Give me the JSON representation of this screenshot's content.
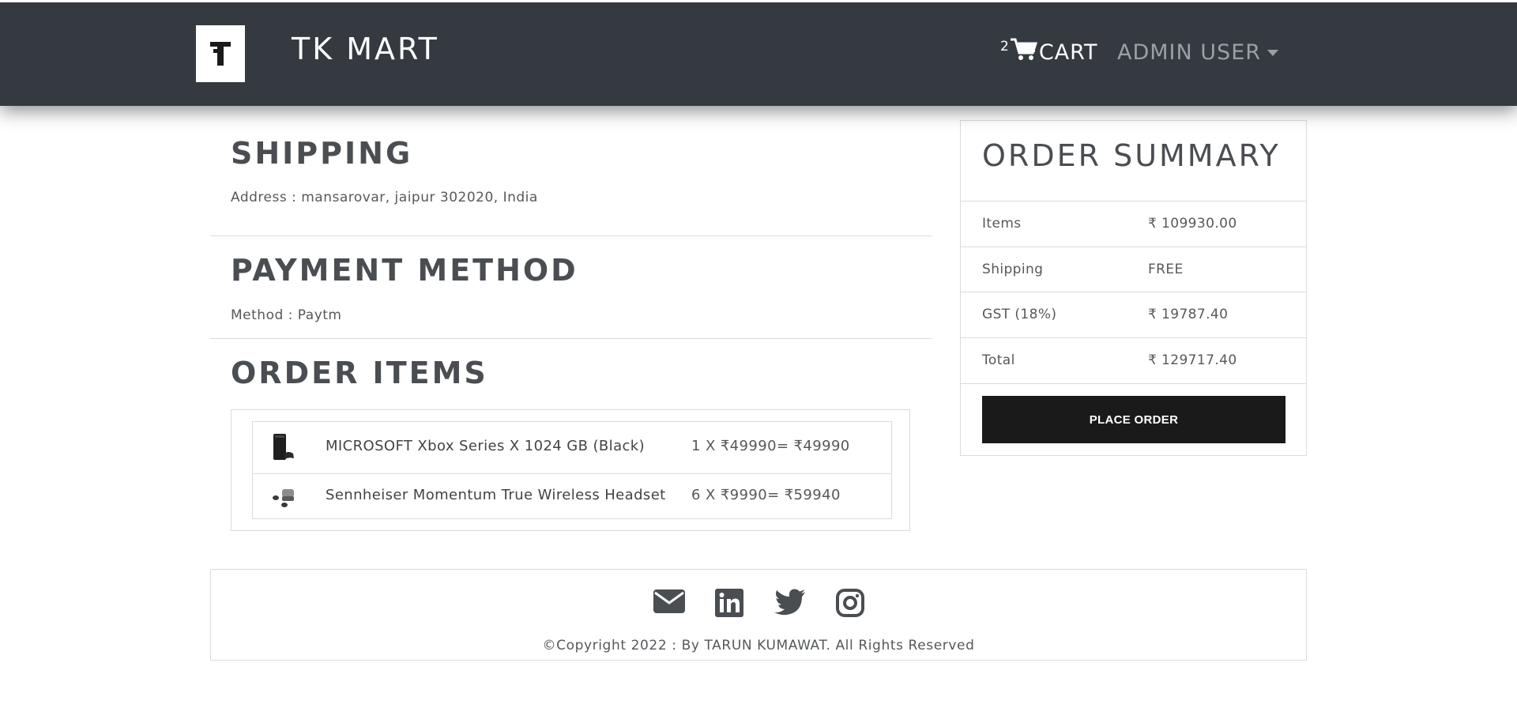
{
  "navbar": {
    "brand": "TK MART",
    "cart_count": "2",
    "cart_label": "CART",
    "user_label": "ADMIN USER"
  },
  "shipping": {
    "title": "SHIPPING",
    "address": "Address : mansarovar, jaipur 302020, India"
  },
  "payment": {
    "title": "PAYMENT METHOD",
    "method": "Method : Paytm"
  },
  "order_items": {
    "title": "ORDER ITEMS",
    "items": [
      {
        "name": "MICROSOFT Xbox Series X 1024 GB (Black)",
        "price": "1 X ₹49990= ₹49990",
        "icon": "console-thumbnail"
      },
      {
        "name": "Sennheiser Momentum True Wireless Headset",
        "price": "6 X ₹9990= ₹59940",
        "icon": "earbuds-thumbnail"
      }
    ]
  },
  "summary": {
    "title": "ORDER SUMMARY",
    "rows": [
      {
        "label": "Items",
        "value": "₹ 109930.00"
      },
      {
        "label": "Shipping",
        "value": "FREE"
      },
      {
        "label": "GST (18%)",
        "value": "₹ 19787.40"
      },
      {
        "label": "Total",
        "value": "₹ 129717.40"
      }
    ],
    "button": "PLACE ORDER"
  },
  "footer": {
    "icons": [
      "email-icon",
      "linkedin-icon",
      "twitter-icon",
      "instagram-icon"
    ],
    "copyright": "©Copyright 2022 : By TARUN KUMAWAT. All Rights Reserved"
  },
  "colors": {
    "navbar": "#343a40",
    "button": "#1a1a1a",
    "text": "#55595c"
  }
}
